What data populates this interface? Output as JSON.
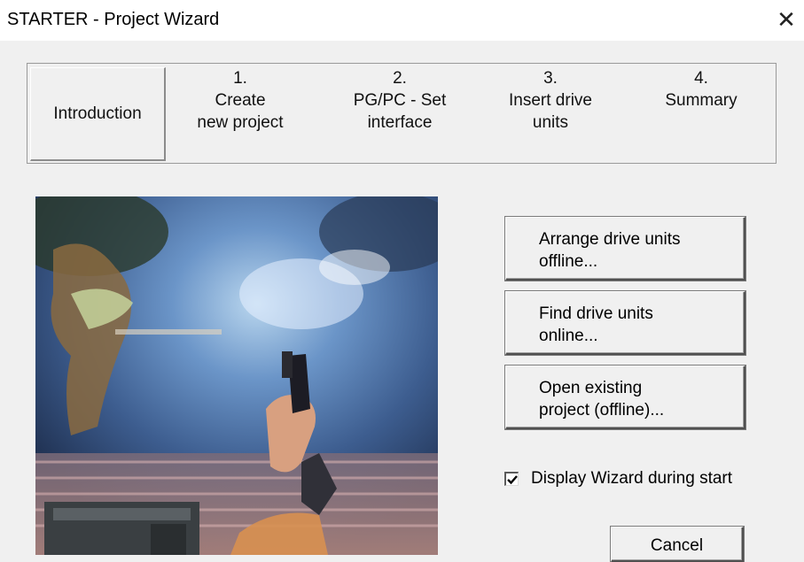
{
  "window": {
    "title": "STARTER - Project Wizard",
    "close_glyph": "✕",
    "close_icon": "close-icon"
  },
  "steps": [
    {
      "num": "",
      "label": "Introduction",
      "active": true
    },
    {
      "num": "1.",
      "label": "Create\nnew project",
      "active": false
    },
    {
      "num": "2.",
      "label": "PG/PC - Set\ninterface",
      "active": false
    },
    {
      "num": "3.",
      "label": "Insert drive\nunits",
      "active": false
    },
    {
      "num": "4.",
      "label": "Summary",
      "active": false
    }
  ],
  "buttons": {
    "arrange": "Arrange drive units\noffline...",
    "find": "Find drive units\nonline...",
    "open": "Open existing\nproject (offline)...",
    "cancel": "Cancel"
  },
  "checkbox": {
    "label": "Display Wizard during start",
    "checked": true
  },
  "colors": {
    "dialog_bg": "#f0f0f0",
    "titlebar_bg": "#ffffff",
    "picture_blue": "#4a6ea8"
  }
}
